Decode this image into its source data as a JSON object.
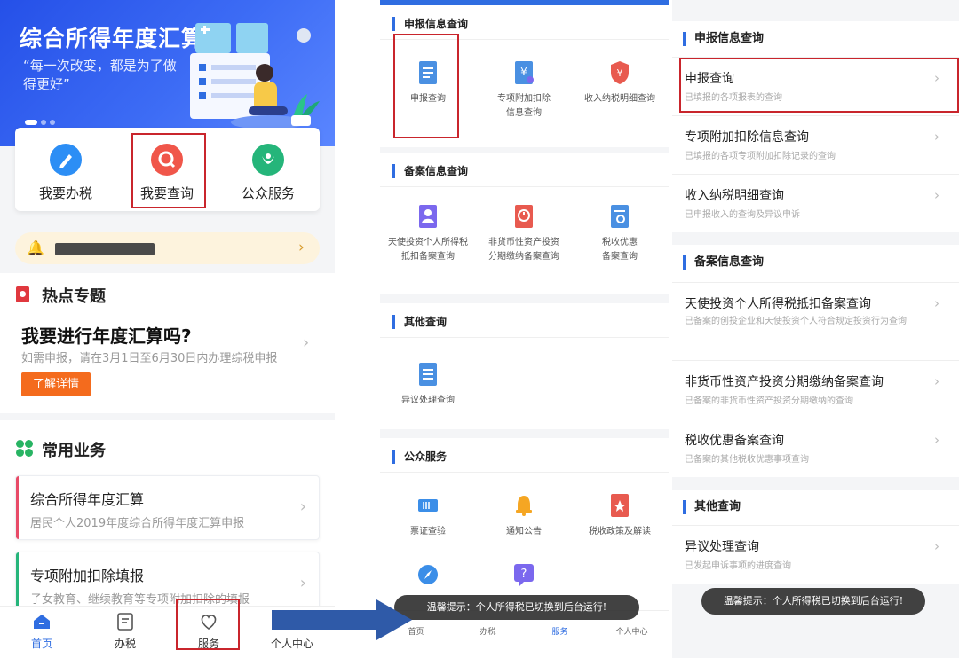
{
  "panel1": {
    "banner": {
      "title": "综合所得年度汇算",
      "slogan": "“每一次改变，都是为了做得更好”"
    },
    "actions": [
      {
        "label": "我要办税",
        "icon": "pen-icon",
        "color": "#2c8ef5"
      },
      {
        "label": "我要查询",
        "icon": "search-icon",
        "color": "#f0564a"
      },
      {
        "label": "公众服务",
        "icon": "flower-icon",
        "color": "#25b57a"
      }
    ],
    "hot": {
      "title": "热点专题",
      "question": "我要进行年度汇算吗?",
      "desc": "如需申报，请在3月1日至6月30日内办理综税申报",
      "button": "了解详情"
    },
    "common": {
      "title": "常用业务",
      "items": [
        {
          "title": "综合所得年度汇算",
          "desc": "居民个人2019年度综合所得年度汇算申报",
          "accent": "#e84a67"
        },
        {
          "title": "专项附加扣除填报",
          "desc": "子女教育、继续教育等专项附加扣除的填报",
          "accent": "#25b57a"
        }
      ]
    },
    "tabs": [
      "首页",
      "办税",
      "服务",
      "个人中心"
    ]
  },
  "panel2": {
    "sections": [
      {
        "title": "申报信息查询",
        "items": [
          {
            "label": "申报查询",
            "icon": "document-icon",
            "color": "#4a90e2"
          },
          {
            "label": "专项附加扣除信息查询",
            "icon": "deduction-icon",
            "color": "#4a90e2"
          },
          {
            "label": "收入纳税明细查询",
            "icon": "shield-yen-icon",
            "color": "#e85a4f"
          }
        ]
      },
      {
        "title": "备案信息查询",
        "items": [
          {
            "label": "天使投资个人所得税抵扣备案查询",
            "icon": "investor-icon",
            "color": "#7b68ee"
          },
          {
            "label": "非货币性资产投资分期缴纳备案查询",
            "icon": "clock-doc-icon",
            "color": "#e85a4f"
          },
          {
            "label": "税收优惠备案查询",
            "icon": "doc-search-icon",
            "color": "#4a90e2"
          }
        ]
      },
      {
        "title": "其他查询",
        "items": [
          {
            "label": "异议处理查询",
            "icon": "objection-doc-icon",
            "color": "#4a90e2"
          }
        ]
      },
      {
        "title": "公众服务",
        "items": [
          {
            "label": "票证查验",
            "icon": "ticket-icon",
            "color": "#3b8ee8"
          },
          {
            "label": "通知公告",
            "icon": "bell-icon",
            "color": "#f5a623"
          },
          {
            "label": "税收政策及解读",
            "icon": "policy-icon",
            "color": "#e85a4f"
          }
        ]
      }
    ],
    "tabs": [
      "首页",
      "办税",
      "服务",
      "个人中心"
    ],
    "toast": "温馨提示：个人所得税已切换到后台运行!"
  },
  "panel3": {
    "sections": [
      {
        "title": "申报信息查询",
        "rows": [
          {
            "title": "申报查询",
            "desc": "已填报的各项报表的查询"
          },
          {
            "title": "专项附加扣除信息查询",
            "desc": "已填报的各项专项附加扣除记录的查询"
          },
          {
            "title": "收入纳税明细查询",
            "desc": "已申报收入的查询及异议申诉"
          }
        ]
      },
      {
        "title": "备案信息查询",
        "rows": [
          {
            "title": "天使投资个人所得税抵扣备案查询",
            "desc": "已备案的创投企业和天使投资个人符合规定投资行为查询"
          },
          {
            "title": "非货币性资产投资分期缴纳备案查询",
            "desc": "已备案的非货币性资产投资分期缴纳的查询"
          },
          {
            "title": "税收优惠备案查询",
            "desc": "已备案的其他税收优惠事项查询"
          }
        ]
      },
      {
        "title": "其他查询",
        "rows": [
          {
            "title": "异议处理查询",
            "desc": "已发起申诉事项的进度查询"
          }
        ]
      }
    ],
    "toast": "温馨提示：个人所得税已切换到后台运行!"
  },
  "colors": {
    "highlight": "#c9252c",
    "accent": "#2f6de1",
    "orange": "#f46b1d"
  }
}
